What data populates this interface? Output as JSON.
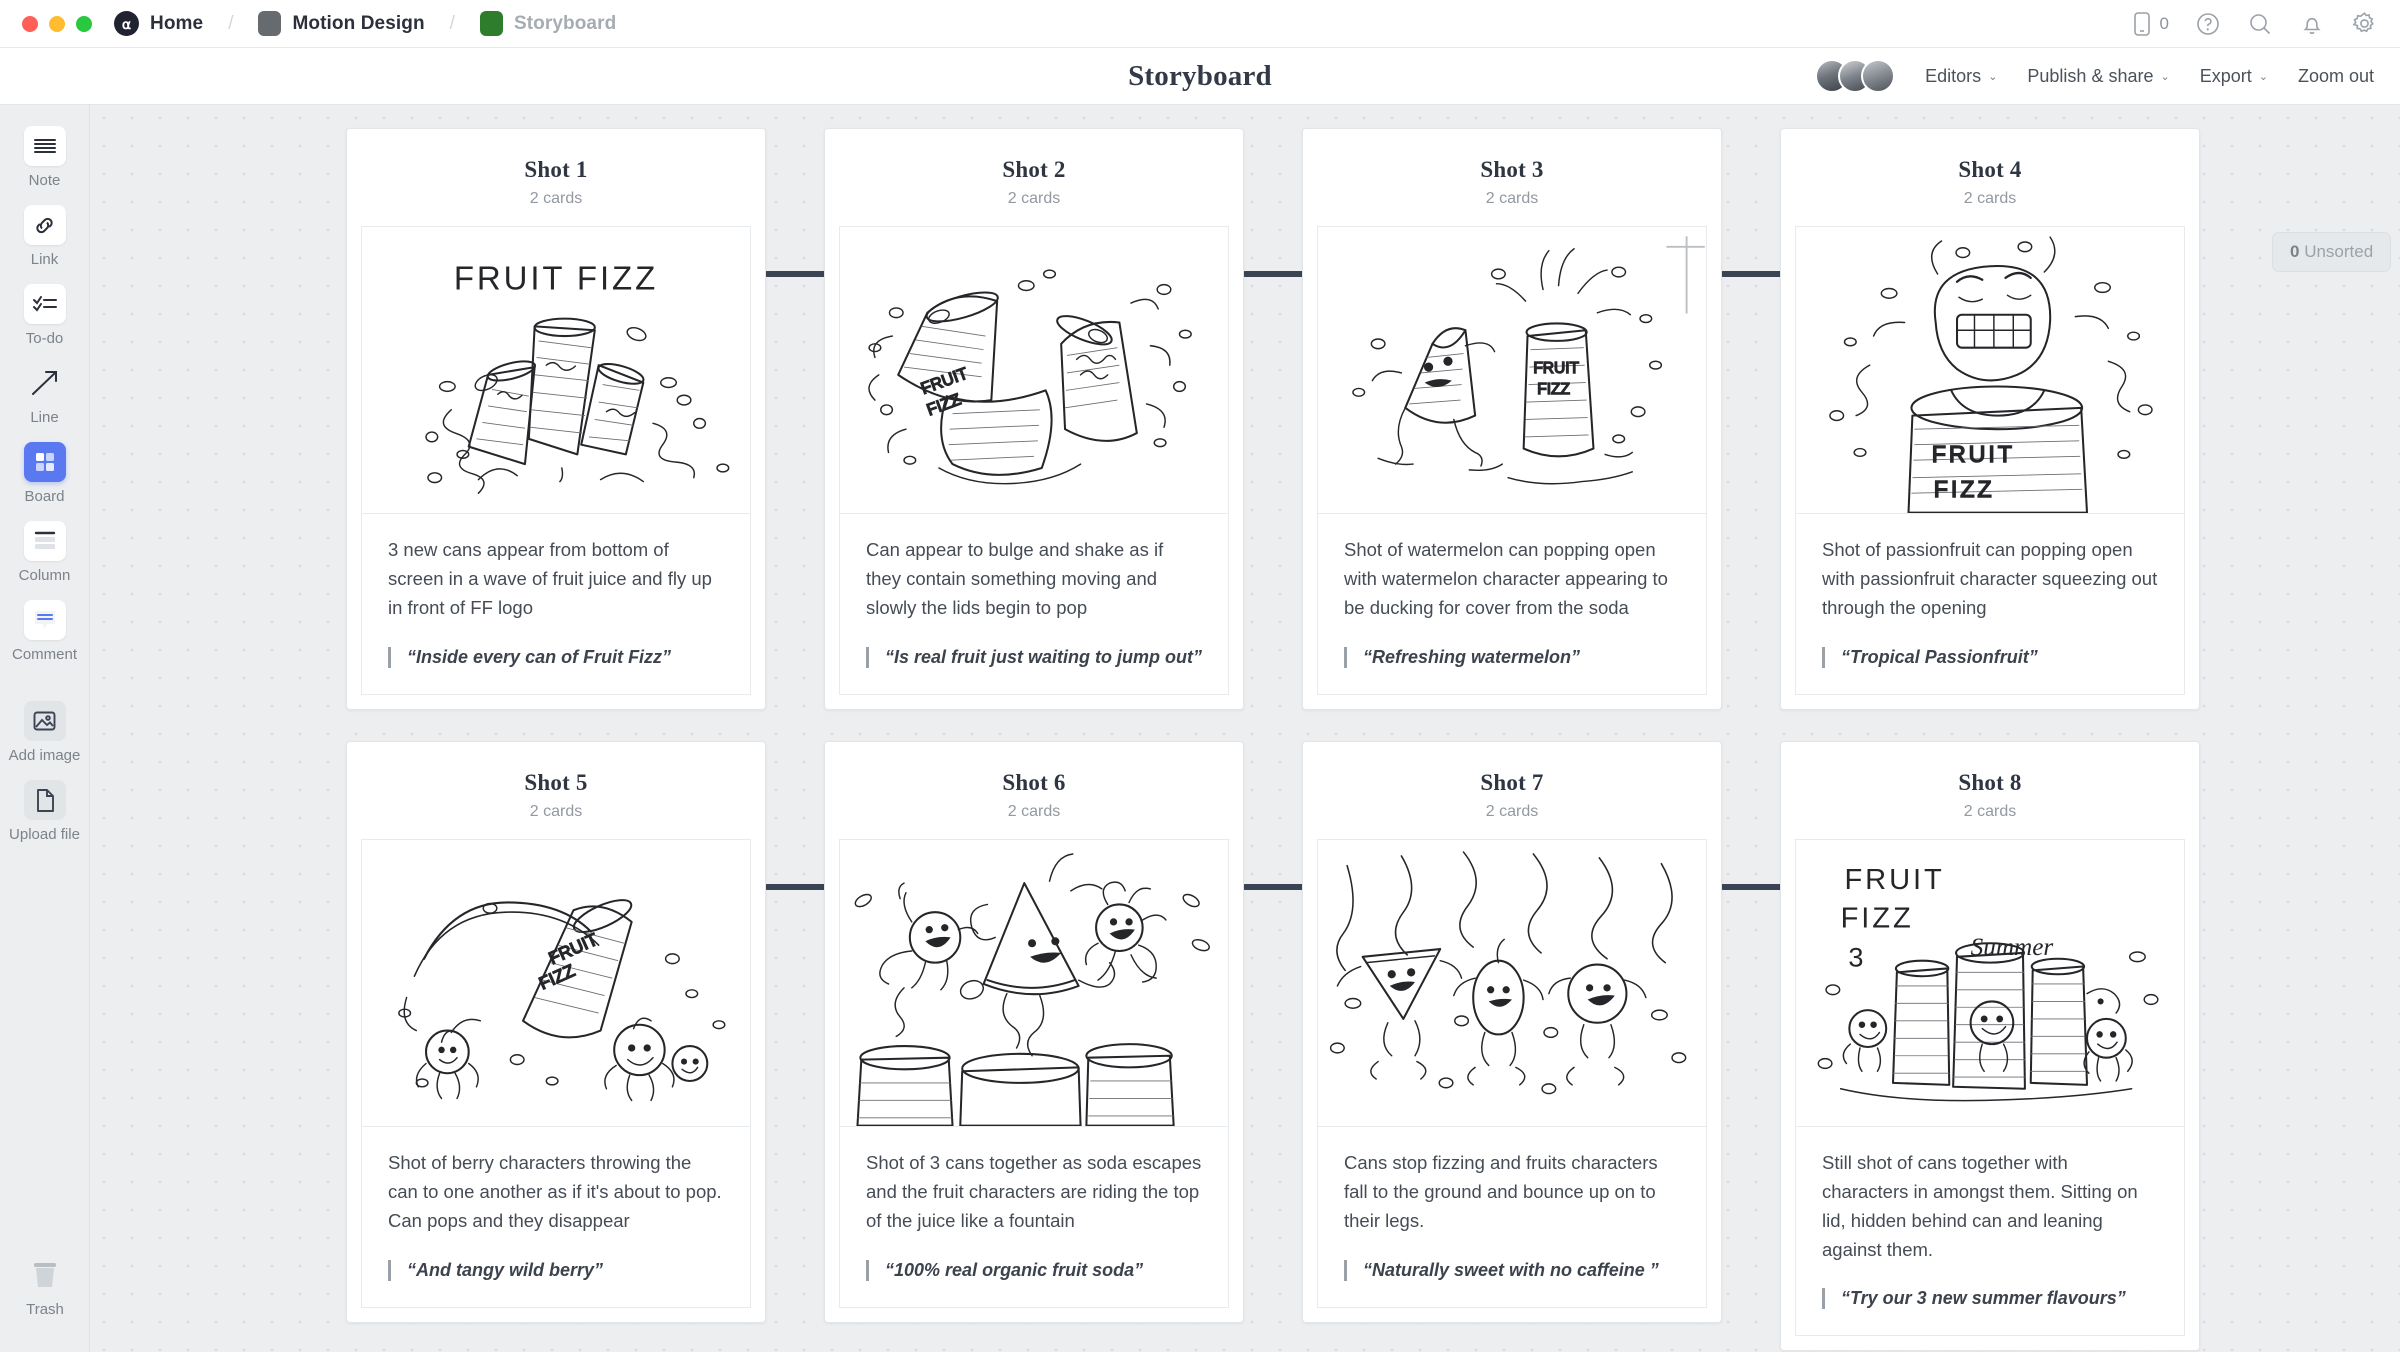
{
  "window": {
    "traffic_lights": [
      "close",
      "minimize",
      "maximize"
    ]
  },
  "breadcrumb": {
    "home": "Home",
    "project": "Motion Design",
    "current": "Storyboard",
    "separator": "/"
  },
  "topbar_right": {
    "device_count": "0",
    "icons": [
      "mobile-preview-icon",
      "help-icon",
      "search-icon",
      "notifications-icon",
      "settings-icon"
    ]
  },
  "header": {
    "title": "Storyboard",
    "editors_label": "Editors",
    "publish_label": "Publish & share",
    "export_label": "Export",
    "zoom_label": "Zoom out",
    "caret": "⌄"
  },
  "sidebar": {
    "items": [
      {
        "label": "Note",
        "icon": "note-icon",
        "active": false
      },
      {
        "label": "Link",
        "icon": "link-icon",
        "active": false
      },
      {
        "label": "To-do",
        "icon": "todo-icon",
        "active": false
      },
      {
        "label": "Line",
        "icon": "line-arrow-icon",
        "active": false
      },
      {
        "label": "Board",
        "icon": "board-icon",
        "active": true
      },
      {
        "label": "Column",
        "icon": "column-icon",
        "active": false
      },
      {
        "label": "Comment",
        "icon": "comment-icon",
        "active": false
      },
      {
        "label": "Add image",
        "icon": "image-icon",
        "active": false
      },
      {
        "label": "Upload file",
        "icon": "file-icon",
        "active": false
      }
    ],
    "trash": {
      "label": "Trash",
      "icon": "trash-icon"
    }
  },
  "canvas": {
    "unsorted_count": "0",
    "unsorted_label": "Unsorted"
  },
  "shots": [
    {
      "title": "Shot 1",
      "cards": "2 cards",
      "sketch": "three-cans-in-juice-splash-with-fruit-fizz-logo",
      "sketch_text": "FRUIT FIZZ",
      "description": "3 new cans appear from bottom of screen in a wave of fruit juice and fly up in front of FF logo",
      "quote": "“Inside every can of Fruit Fizz”"
    },
    {
      "title": "Shot 2",
      "cards": "2 cards",
      "sketch": "two-bulging-cans-shaking-with-lids-popping",
      "sketch_text": "FRUIT FIZZ",
      "description": "Can appear to bulge and shake as if they contain something moving and slowly the lids begin to pop",
      "quote": "“Is real fruit just waiting to jump out”"
    },
    {
      "title": "Shot 3",
      "cards": "2 cards",
      "sketch": "watermelon-character-ducking-beside-popping-can",
      "sketch_text": "FRUIT FIZZ",
      "description": "Shot of watermelon can popping open with watermelon character appearing to be ducking for cover from the soda",
      "quote": "“Refreshing watermelon”"
    },
    {
      "title": "Shot 4",
      "cards": "2 cards",
      "sketch": "passionfruit-character-squeezing-out-of-can-opening",
      "sketch_text": "FRUIT FIZZ",
      "description": "Shot of passionfruit can popping open with passionfruit character squeezing out through the opening",
      "quote": "“Tropical Passionfruit”"
    },
    {
      "title": "Shot 5",
      "cards": "2 cards",
      "sketch": "berry-characters-throwing-can-with-juice-arc",
      "sketch_text": "FRUIT FIZZ",
      "description": "Shot of berry characters throwing the can to one another as if it's about to pop. Can pops and they disappear",
      "quote": "“And tangy wild berry”"
    },
    {
      "title": "Shot 6",
      "cards": "2 cards",
      "sketch": "three-cans-with-fruit-characters-riding-juice-fountain",
      "sketch_text": "",
      "description": "Shot of 3 cans together as soda escapes and the fruit characters are riding the top of the juice like a fountain",
      "quote": "“100% real organic fruit soda”"
    },
    {
      "title": "Shot 7",
      "cards": "2 cards",
      "sketch": "fruit-characters-falling-and-bouncing-onto-legs",
      "sketch_text": "",
      "description": "Cans stop fizzing and fruits characters fall to the ground and bounce up on to their legs.",
      "quote": "“Naturally sweet with no caffeine ”"
    },
    {
      "title": "Shot 8",
      "cards": "2 cards",
      "sketch": "group-shot-of-cans-and-characters-with-summer-flavours-logo",
      "sketch_text": "FRUIT FIZZ 3 Summer",
      "description": "Still shot of cans together with characters in amongst them. Sitting on lid, hidden behind can and leaning against them.",
      "quote": "“Try our 3 new summer flavours”"
    }
  ],
  "colors": {
    "accent": "#5a78f0",
    "canvas_bg": "#eceef0",
    "card_bg": "#ffffff",
    "text_primary": "#2f3642",
    "text_muted": "#9299a1",
    "connector": "#3b4452"
  }
}
